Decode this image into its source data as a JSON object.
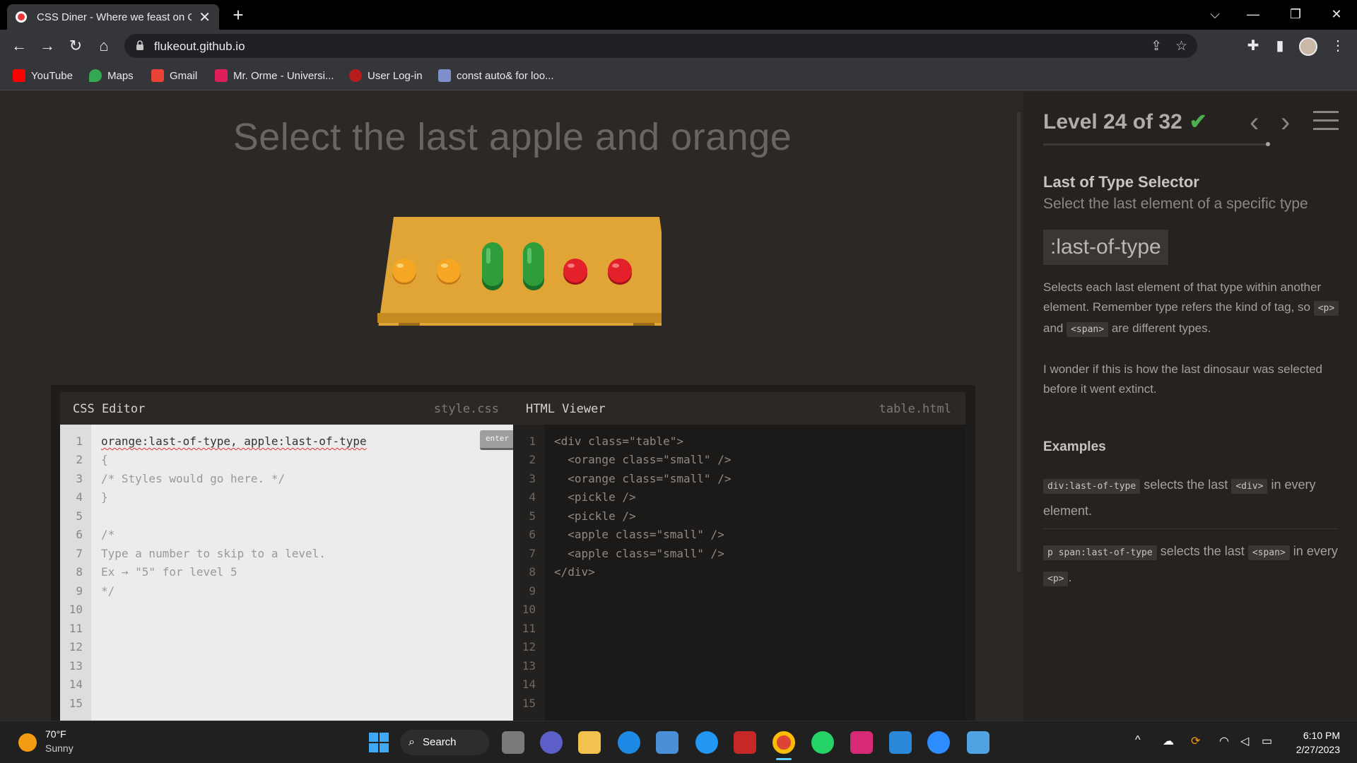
{
  "browser": {
    "tab_title": "CSS Diner - Where we feast on CSS",
    "url": "flukeout.github.io",
    "bookmarks": [
      "YouTube",
      "Maps",
      "Gmail",
      "Mr. Orme - Universi...",
      "User Log-in",
      "const auto& for loo..."
    ]
  },
  "game": {
    "order": "Select the last apple and orange",
    "table_items": [
      "orange-small",
      "orange-small",
      "pickle",
      "pickle",
      "apple-small",
      "apple-small"
    ]
  },
  "css_editor": {
    "title": "CSS Editor",
    "filename": "style.css",
    "enter_label": "enter",
    "input_value": "orange:last-of-type, apple:last-of-type",
    "lines": [
      "{",
      "/* Styles would go here. */",
      "}",
      "",
      "/*",
      "Type a number to skip to a level.",
      "Ex → \"5\" for level 5",
      "*/"
    ],
    "line_numbers": [
      "1",
      "2",
      "3",
      "4",
      "5",
      "6",
      "7",
      "8",
      "9",
      "10",
      "11",
      "12",
      "13",
      "14",
      "15"
    ]
  },
  "html_viewer": {
    "title": "HTML Viewer",
    "filename": "table.html",
    "lines": [
      "<div class=\"table\">",
      "  <orange class=\"small\" />",
      "  <orange class=\"small\" />",
      "  <pickle />",
      "  <pickle />",
      "  <apple class=\"small\" />",
      "  <apple class=\"small\" />",
      "</div>"
    ],
    "line_numbers": [
      "1",
      "2",
      "3",
      "4",
      "5",
      "6",
      "7",
      "8",
      "9",
      "10",
      "11",
      "12",
      "13",
      "14",
      "15"
    ]
  },
  "sidebar": {
    "level_text": "Level 24 of 32",
    "check": "✔",
    "selector_name": "Last of Type Selector",
    "selector_title": "Select the last element of a specific type",
    "syntax": ":last-of-type",
    "hint_p1_a": "Selects each last element of that type within another element. Remember type refers the kind of tag, so",
    "hint_p1_code1": "<p>",
    "hint_p1_and": "and",
    "hint_p1_code2": "<span>",
    "hint_p1_b": "are different types.",
    "hint_p2": "I wonder if this is how the last dinosaur was selected before it went extinct.",
    "examples_heading": "Examples",
    "ex1_code": "div:last-of-type",
    "ex1_text": "selects the last",
    "ex1_code2": "<div>",
    "ex1_tail": "in every element.",
    "ex2_code": "p span:last-of-type",
    "ex2_text": "selects the last",
    "ex2_code2": "<span>",
    "ex2_in": "in",
    "ex2_every": "every",
    "ex2_code3": "<p>",
    "ex2_period": "."
  },
  "taskbar": {
    "temp": "70°F",
    "condition": "Sunny",
    "search_label": "Search",
    "time": "6:10 PM",
    "date": "2/27/2023"
  },
  "colors": {
    "orange": "#f5a623",
    "pickle": "#2e9d3a",
    "apple": "#e4202b",
    "table": "#e0a535"
  }
}
